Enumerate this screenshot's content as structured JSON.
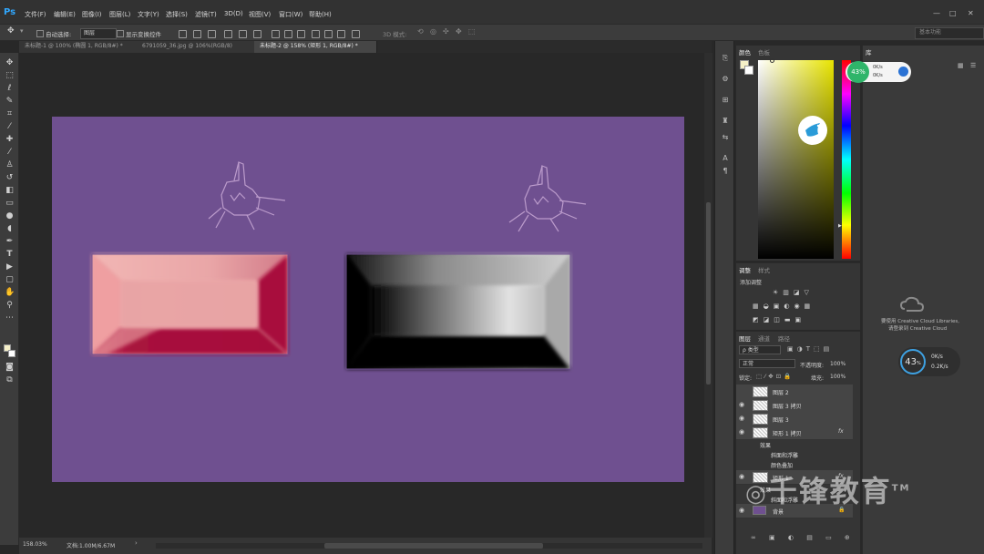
{
  "app": {
    "logo": "Ps"
  },
  "menu": [
    "文件(F)",
    "编辑(E)",
    "图像(I)",
    "图层(L)",
    "文字(Y)",
    "选择(S)",
    "滤镜(T)",
    "3D(D)",
    "视图(V)",
    "窗口(W)",
    "帮助(H)"
  ],
  "window_controls": [
    "—",
    "□",
    "✕"
  ],
  "options": {
    "auto_select_label": "自动选择:",
    "auto_select_value": "图层",
    "show_transform_label": "显示变换控件",
    "mode_3d_label": "3D 模式:",
    "workspace": "基本功能"
  },
  "tabs": [
    {
      "label": "未标题-1 @ 100% (椭圆 1, RGB/8#) *",
      "active": false
    },
    {
      "label": "6791059_36.jpg @ 106%(RGB/8)",
      "active": false
    },
    {
      "label": "未标题-2 @ 158% (矩形 1, RGB/8#) *",
      "active": true
    }
  ],
  "status": {
    "zoom": "158.03%",
    "doc": "文档:1.00M/6.67M"
  },
  "colors": {
    "canvas_bg": "#6f5090",
    "pink_light": "#f0a8a8",
    "crimson": "#a8103c",
    "accent": "#31a8ff"
  },
  "color_panel": {
    "tabs": [
      "颜色",
      "色板"
    ]
  },
  "adjust_panel": {
    "tabs": [
      "调整",
      "样式"
    ],
    "add_label": "添加调整"
  },
  "layers_panel": {
    "tabs": [
      "图层",
      "通道",
      "路径"
    ],
    "kind_filter": "ρ 类型",
    "blend_mode": "正常",
    "opacity_label": "不透明度:",
    "opacity_value": "100%",
    "lock_label": "锁定:",
    "fill_label": "填充:",
    "fill_value": "100%",
    "layers": [
      {
        "name": "图层 2",
        "visible": false,
        "fx": false
      },
      {
        "name": "图层 3 拷贝",
        "visible": true,
        "fx": false
      },
      {
        "name": "图层 3",
        "visible": true,
        "fx": false
      },
      {
        "name": "矩形 1 拷贝",
        "visible": true,
        "fx": true
      },
      {
        "name": "矩形 1",
        "visible": true,
        "fx": true
      },
      {
        "name": "背景",
        "visible": true,
        "fx": false
      }
    ],
    "effects_label": "效果",
    "effect_bevel": "斜面和浮雕",
    "effect_color_overlay": "颜色叠加",
    "fx_label": "fx"
  },
  "library_panel": {
    "tab": "库",
    "message_line1": "要使用 Creative Cloud Libraries,",
    "message_line2": "请登录到 Creative Cloud"
  },
  "meters": {
    "top": {
      "percent": "43",
      "unit": "%",
      "up": "0K/s",
      "down": "0K/s"
    },
    "bottom": {
      "percent": "43",
      "unit": "%",
      "up": "0K/s",
      "down": "0.2K/s"
    }
  },
  "watermark": "千锋教育"
}
